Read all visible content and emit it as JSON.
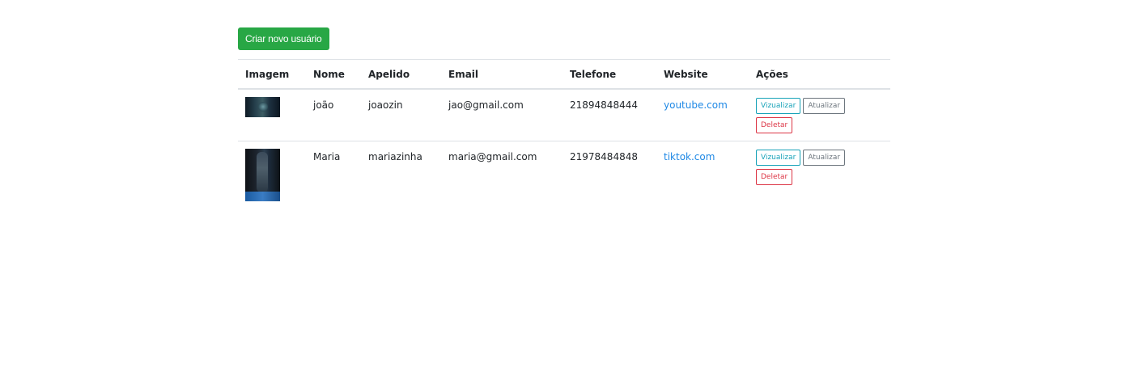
{
  "create_button": "Criar novo usuário",
  "table": {
    "headers": {
      "imagem": "Imagem",
      "nome": "Nome",
      "apelido": "Apelido",
      "email": "Email",
      "telefone": "Telefone",
      "website": "Website",
      "acoes": "Ações"
    },
    "rows": [
      {
        "nome": "joão",
        "apelido": "joaozin",
        "email": "jao@gmail.com",
        "telefone": "21894848444",
        "website": "youtube.com",
        "actions": {
          "view": "Vizualizar",
          "update": "Atualizar",
          "delete": "Deletar"
        }
      },
      {
        "nome": "Maria",
        "apelido": "mariazinha",
        "email": "maria@gmail.com",
        "telefone": "21978484848",
        "website": "tiktok.com",
        "actions": {
          "view": "Vizualizar",
          "update": "Atualizar",
          "delete": "Deletar"
        }
      }
    ]
  },
  "colors": {
    "primary_green": "#28a745",
    "link_blue": "#1e88e5",
    "info": "#17a2b8",
    "secondary": "#6c757d",
    "danger": "#dc3545"
  }
}
